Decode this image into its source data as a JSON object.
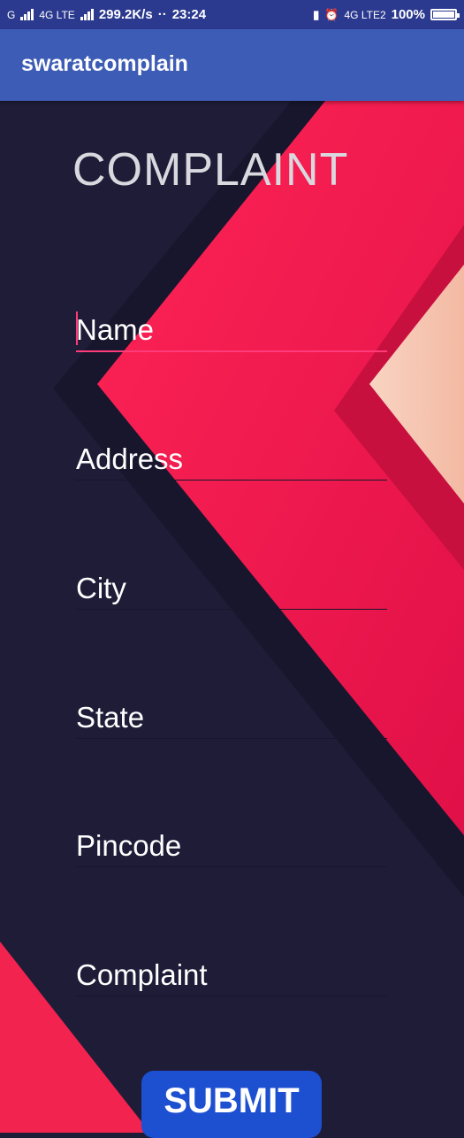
{
  "status_bar": {
    "network_left": "G",
    "lte_label": "4G LTE",
    "speed": "299.2K/s",
    "dots": "··",
    "time": "23:24",
    "lte2_label": "4G LTE2",
    "battery": "100%"
  },
  "app_bar": {
    "title": "swaratcomplain"
  },
  "form": {
    "heading": "COMPLAINT",
    "name_placeholder": "Name",
    "address_placeholder": "Address",
    "city_placeholder": "City",
    "state_placeholder": "State",
    "pincode_placeholder": "Pincode",
    "complaint_placeholder": "Complaint",
    "submit_label": "SUBMIT"
  },
  "colors": {
    "status_bar": "#2b3a8f",
    "app_bar": "#3d5cb5",
    "background": "#1f1c38",
    "accent": "#ff3b7a",
    "button": "#1d4fd1"
  }
}
